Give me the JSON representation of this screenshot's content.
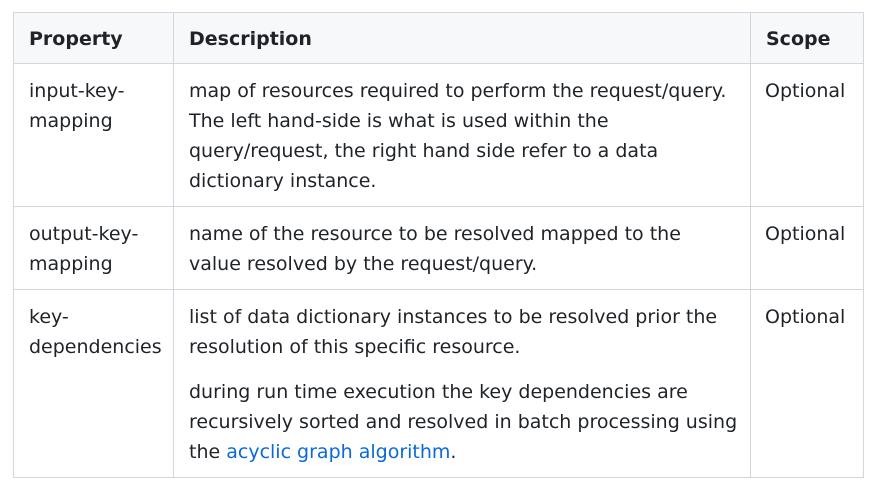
{
  "table": {
    "headers": {
      "property": "Property",
      "description": "Description",
      "scope": "Scope"
    },
    "rows": [
      {
        "property": "input-key-mapping",
        "description": "map of resources required to perform the request/query. The left hand-side is what is used within the query/request, the right hand side refer to a data dictionary instance.",
        "scope": "Optional"
      },
      {
        "property": "output-key-mapping",
        "description": "name of the resource to be resolved mapped to the value resolved by the request/query.",
        "scope": "Optional"
      },
      {
        "property": "key-dependencies",
        "description": "list of data dictionary instances to be resolved prior the resolution of this specific resource.",
        "description_2_prefix": "during run time execution the key dependencies are recursively sorted and resolved in batch processing using the",
        "description_2_link": "acyclic graph algorithm",
        "description_2_suffix": ".",
        "scope": "Optional"
      }
    ]
  },
  "colors": {
    "link": "#0969da",
    "header_bg": "#f6f8fa",
    "border": "#d0d7de",
    "text": "#1f2328"
  }
}
